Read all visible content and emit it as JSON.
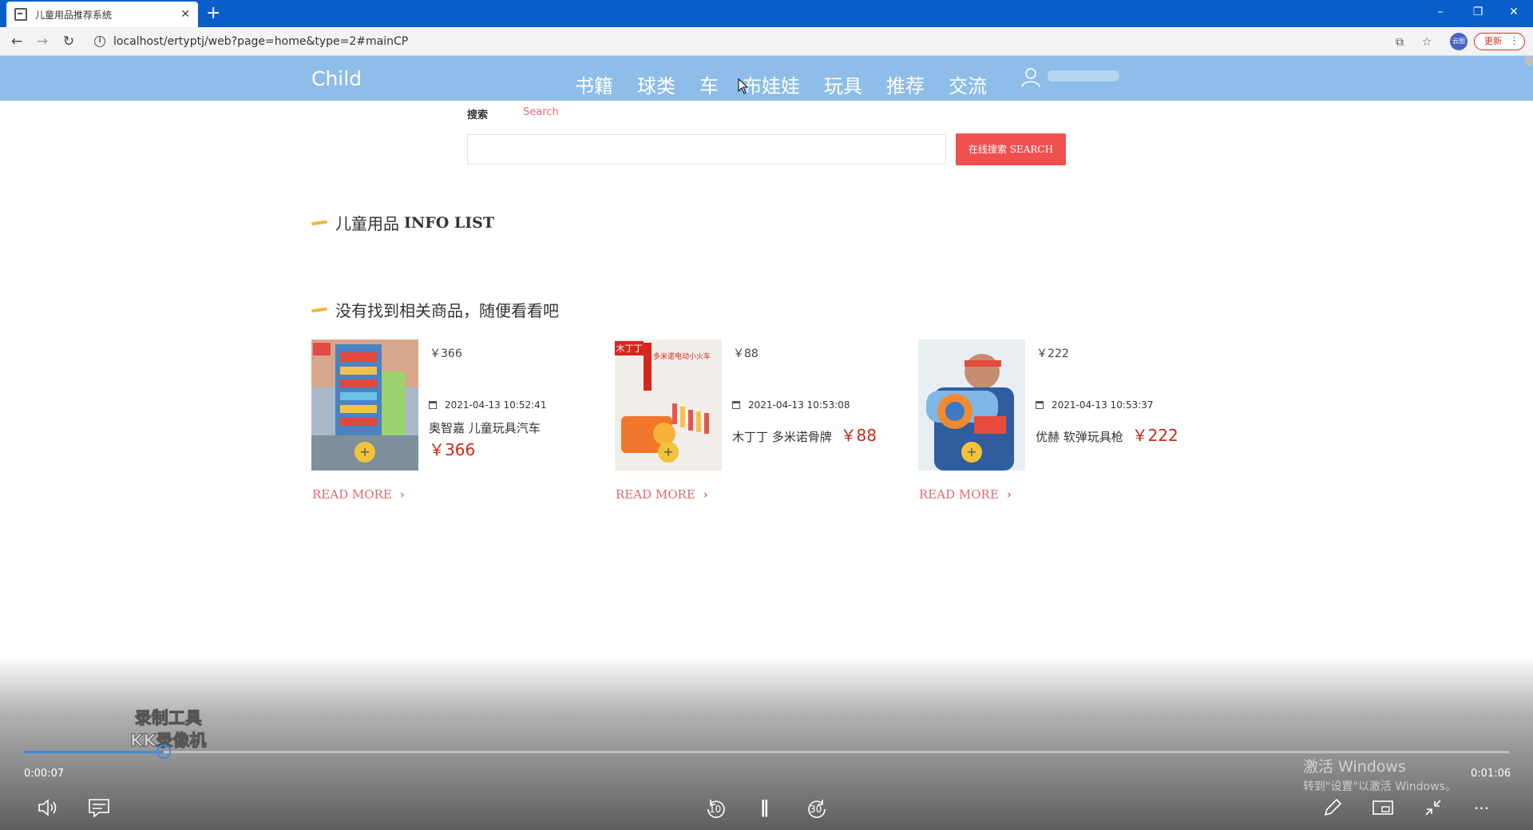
{
  "browser": {
    "tab_title": "儿童用品推荐系统",
    "url": "localhost/ertyptj/web?page=home&type=2#mainCP",
    "update_label": "更新",
    "avatar_label": "云图"
  },
  "site": {
    "logo": "Child",
    "nav": [
      "书籍",
      "球类",
      "车",
      "布娃娃",
      "玩具",
      "推荐",
      "交流"
    ]
  },
  "search": {
    "tab_cn": "搜索",
    "tab_en": "Search",
    "input_value": "",
    "button_label": "在线搜索 SEARCH"
  },
  "sections": {
    "info_cn": "儿童用品",
    "info_en": "INFO LIST",
    "notfound": "没有找到相关商品，随便看看吧"
  },
  "products": [
    {
      "price_small": "￥366",
      "date": "2021-04-13 10:52:41",
      "name": "奥智嘉 儿童玩具汽车",
      "price_big": "￥366",
      "read_more": "READ MORE",
      "thumb_icon": "toy-car-garage-image"
    },
    {
      "price_small": "￥88",
      "date": "2021-04-13 10:53:08",
      "name": "木丁丁 多米诺骨牌",
      "price_big": "￥88",
      "read_more": "READ MORE",
      "thumb_icon": "domino-train-image",
      "thumb_badge": "木丁丁",
      "thumb_caption": "多米诺电动小火车"
    },
    {
      "price_small": "￥222",
      "date": "2021-04-13 10:53:37",
      "name": "优赫 软弹玩具枪",
      "price_big": "￥222",
      "read_more": "READ MORE",
      "thumb_icon": "toy-gun-image"
    }
  ],
  "player": {
    "current_time": "0:00:07",
    "total_time": "0:01:06",
    "progress": 0.094,
    "rewind_label": "10",
    "forward_label": "30",
    "watermark_line1": "录制工具",
    "watermark_line2": "KK录像机",
    "activate_line1": "激活 Windows",
    "activate_line2": "转到\"设置\"以激活 Windows。"
  }
}
